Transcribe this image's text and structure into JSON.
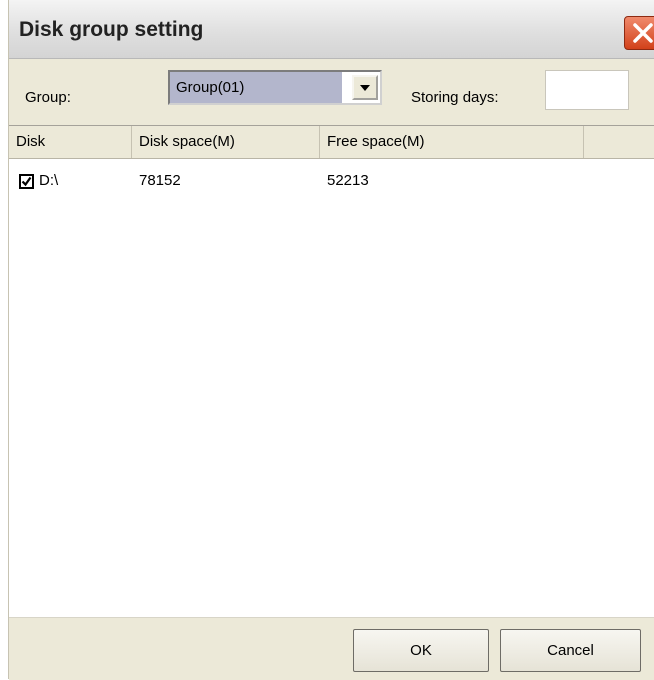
{
  "window": {
    "title": "Disk group setting"
  },
  "toolbar": {
    "group_label": "Group:",
    "group_value": "Group(01)",
    "storing_days_label": "Storing days:",
    "storing_days_value": ""
  },
  "list": {
    "columns": [
      "Disk",
      "Disk space(M)",
      "Free space(M)"
    ],
    "rows": [
      {
        "checked": true,
        "disk": "D:\\",
        "disk_space": "78152",
        "free_space": "52213"
      }
    ]
  },
  "footer": {
    "ok_label": "OK",
    "cancel_label": "Cancel"
  },
  "colors": {
    "window_bg": "#ECE9D8",
    "close_button": "#D2411A",
    "selection": "#B3B6CC"
  }
}
